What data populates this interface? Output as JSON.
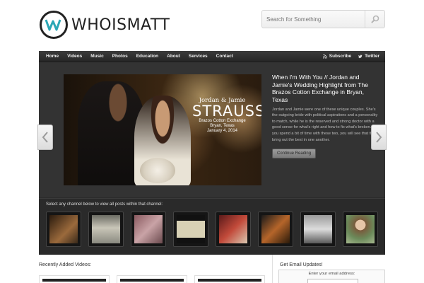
{
  "site": {
    "logo_text": "WHOISMATT"
  },
  "search": {
    "placeholder": "Search for Something",
    "icon": "search-icon"
  },
  "nav": {
    "items": [
      "Home",
      "Videos",
      "Music",
      "Photos",
      "Education",
      "About",
      "Services",
      "Contact"
    ],
    "subscribe": "Subscribe",
    "twitter": "Twitter"
  },
  "featured": {
    "title": "When I'm With You // Jordan and Jamie's Wedding Highlight from The Brazos Cotton Exchange in Bryan, Texas",
    "body": "Jordan and Jamie were one of these unique couples. She's the outgoing bride with political aspirations and a personality to match, while he is the reserved and strong doctor with a good sense for what's right and how to fix what's broken. If you spend a bit of time with these two, you will see that they bring out the best in one another.",
    "button": "Continue Reading",
    "overlay": {
      "names": "Jordan & Jamie",
      "surname": "STRAUSS",
      "venue": "Brazos Cotton Exchange",
      "city": "Bryan, Texas",
      "date": "January 4, 2014"
    }
  },
  "channels": {
    "label": "Select any channel below to view all posts within that channel:",
    "count": 8
  },
  "recent": {
    "title": "Recently Added Videos:"
  },
  "email": {
    "title": "Get Email Updates!",
    "label": "Enter your email address:"
  }
}
